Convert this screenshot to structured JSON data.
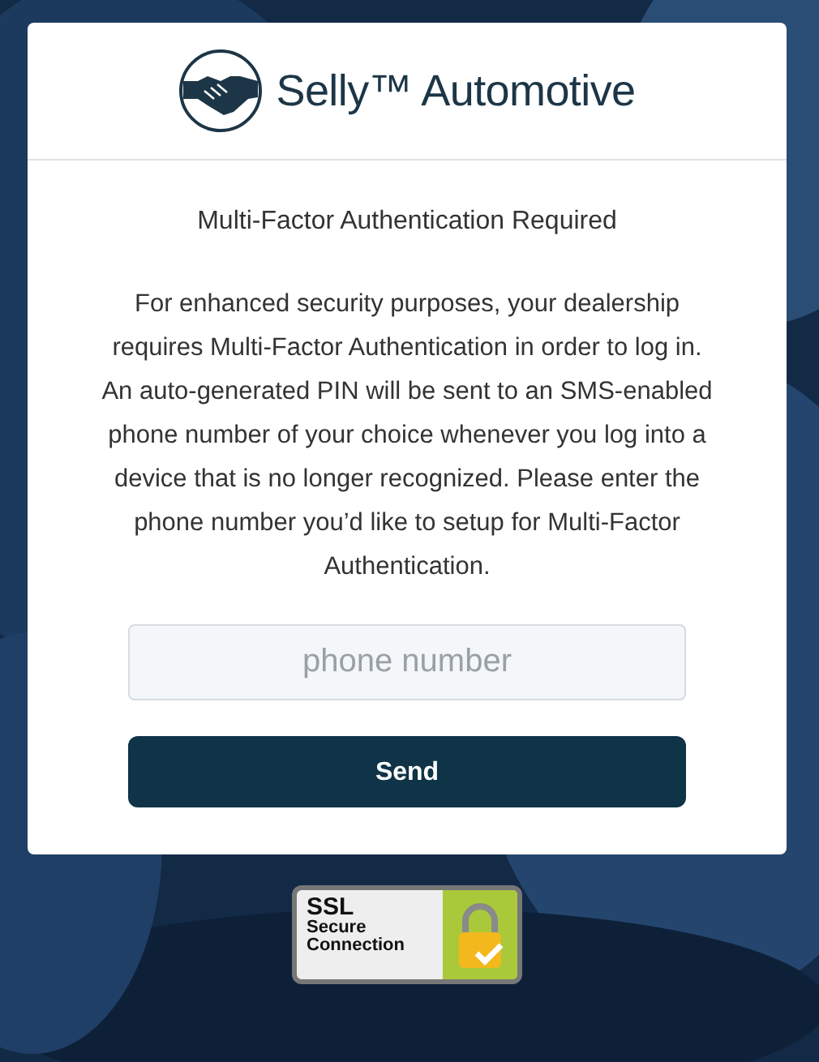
{
  "brand": {
    "name": "Selly™ Automotive"
  },
  "heading": "Multi-Factor Authentication Required",
  "message": "For enhanced security purposes, your dealership requires Multi-Factor Authentication in order to log in. An auto-generated PIN will be sent to an SMS-enabled phone number of your choice whenever you log into a device that is no longer recognized. Please enter the phone number you’d like to setup for Multi-Factor Authentication.",
  "phone_field": {
    "placeholder": "phone number"
  },
  "buttons": [
    "Send"
  ],
  "ssl_badge": {
    "lines": [
      "SSL",
      "Secure",
      "Connection"
    ]
  }
}
